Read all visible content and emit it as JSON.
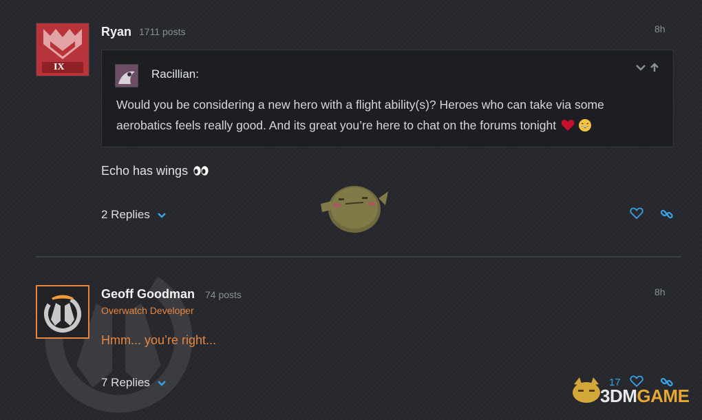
{
  "posts": [
    {
      "author": "Ryan",
      "post_count": "1711 posts",
      "time": "8h",
      "avatar_badge": "IX",
      "quote": {
        "author": "Racillian:",
        "text": "Would you be considering a new hero with a flight ability(s)? Heroes who can take via some aerobatics feels really good. And its great you’re here to chat on the forums tonight",
        "controls": [
          "chevron-down-icon",
          "arrow-up-icon"
        ]
      },
      "body": "Echo has wings",
      "replies": "2 Replies",
      "actions": [
        "heart-icon",
        "link-icon"
      ]
    },
    {
      "author": "Geoff Goodman",
      "post_count": "74 posts",
      "title": "Overwatch Developer",
      "time": "8h",
      "body": "Hmm... you’re right...",
      "replies": "7 Replies",
      "like_count": "17",
      "actions": [
        "heart-icon",
        "link-icon"
      ]
    }
  ],
  "watermark": {
    "brand_prefix": "3DM",
    "brand_suffix": "GAME"
  },
  "colors": {
    "background": "#25272c",
    "accent_blue": "#3aa2e6",
    "developer_orange": "#e9863d",
    "heart_red": "#c8102e"
  }
}
